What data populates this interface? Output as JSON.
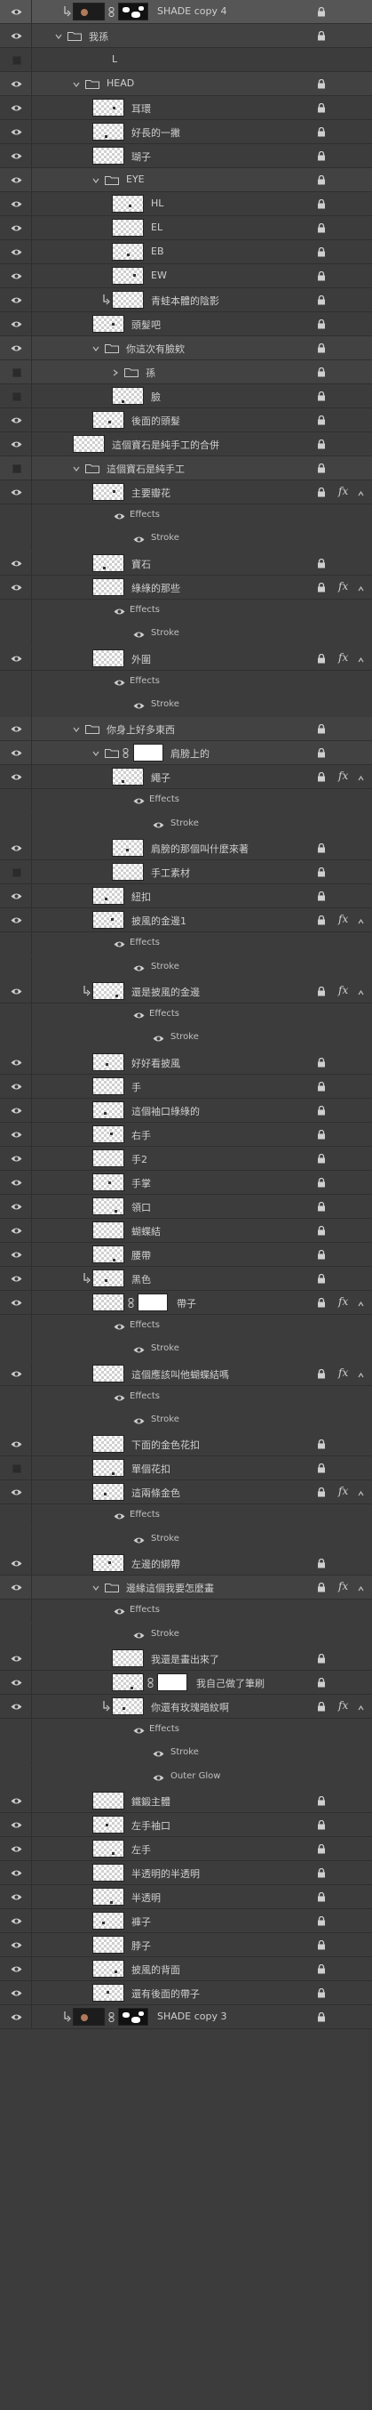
{
  "layers": [
    {
      "type": "layer",
      "label": "SHADE copy 4",
      "indent": 2,
      "vis": "on",
      "clip": true,
      "thumb": "dark",
      "mask": "black",
      "lock": true,
      "selected": true
    },
    {
      "type": "group",
      "label": "我孫",
      "indent": 1,
      "vis": "on",
      "open": true,
      "lock": true
    },
    {
      "type": "layer",
      "label": "L",
      "indent": 2,
      "vis": "off",
      "thumb": "none"
    },
    {
      "type": "group",
      "label": "HEAD",
      "indent": 2,
      "vis": "on",
      "open": true,
      "lock": true
    },
    {
      "type": "layer",
      "label": "耳環",
      "indent": 3,
      "vis": "on",
      "thumb": "check",
      "lock": true
    },
    {
      "type": "layer",
      "label": "好長的一撇",
      "indent": 3,
      "vis": "on",
      "thumb": "check",
      "lock": true
    },
    {
      "type": "layer",
      "label": "瑚子",
      "indent": 3,
      "vis": "on",
      "thumb": "check",
      "lock": true
    },
    {
      "type": "group",
      "label": "EYE",
      "indent": 3,
      "vis": "on",
      "open": true,
      "lock": true
    },
    {
      "type": "layer",
      "label": "HL",
      "indent": 4,
      "vis": "on",
      "thumb": "check",
      "lock": true
    },
    {
      "type": "layer",
      "label": "EL",
      "indent": 4,
      "vis": "on",
      "thumb": "check",
      "lock": true
    },
    {
      "type": "layer",
      "label": "EB",
      "indent": 4,
      "vis": "on",
      "thumb": "check",
      "lock": true
    },
    {
      "type": "layer",
      "label": "EW",
      "indent": 4,
      "vis": "on",
      "thumb": "check",
      "lock": true
    },
    {
      "type": "layer",
      "label": "青蛙本體的陰影",
      "indent": 4,
      "vis": "on",
      "clip": true,
      "thumb": "check",
      "lock": true
    },
    {
      "type": "layer",
      "label": "頭髮吧",
      "indent": 3,
      "vis": "on",
      "thumb": "check",
      "lock": true
    },
    {
      "type": "group",
      "label": "你這次有臉欸",
      "indent": 3,
      "vis": "on",
      "open": true,
      "lock": true
    },
    {
      "type": "group",
      "label": "孫",
      "indent": 4,
      "vis": "off",
      "open": false,
      "lock": true
    },
    {
      "type": "layer",
      "label": "臉",
      "indent": 4,
      "vis": "off",
      "thumb": "check",
      "lock": true
    },
    {
      "type": "layer",
      "label": "後面的頭髮",
      "indent": 3,
      "vis": "on",
      "thumb": "check",
      "lock": true
    },
    {
      "type": "layer",
      "label": "這個寶石是純手工的合併",
      "indent": 2,
      "vis": "on",
      "thumb": "check",
      "lock": true
    },
    {
      "type": "group",
      "label": "這個寶石是純手工",
      "indent": 2,
      "vis": "off",
      "open": true,
      "lock": true
    },
    {
      "type": "layer",
      "label": "主要瓣花",
      "indent": 3,
      "vis": "on",
      "thumb": "check",
      "lock": true,
      "fx": true
    },
    {
      "type": "effects",
      "label": "Effects",
      "indent": 3
    },
    {
      "type": "effect",
      "label": "Stroke",
      "indent": 3
    },
    {
      "type": "layer",
      "label": "寶石",
      "indent": 3,
      "vis": "on",
      "thumb": "check",
      "lock": true
    },
    {
      "type": "layer",
      "label": "綠綠的那些",
      "indent": 3,
      "vis": "on",
      "thumb": "check",
      "lock": true,
      "fx": true
    },
    {
      "type": "effects",
      "label": "Effects",
      "indent": 3
    },
    {
      "type": "effect",
      "label": "Stroke",
      "indent": 3
    },
    {
      "type": "layer",
      "label": "外圍",
      "indent": 3,
      "vis": "on",
      "thumb": "check",
      "lock": true,
      "fx": true
    },
    {
      "type": "effects",
      "label": "Effects",
      "indent": 3
    },
    {
      "type": "effect",
      "label": "Stroke",
      "indent": 3
    },
    {
      "type": "group",
      "label": "你身上好多東西",
      "indent": 2,
      "vis": "on",
      "open": true,
      "lock": true
    },
    {
      "type": "group",
      "label": "肩膀上的",
      "indent": 3,
      "vis": "on",
      "open": true,
      "lock": true,
      "mask": "white"
    },
    {
      "type": "layer",
      "label": "繩子",
      "indent": 4,
      "vis": "on",
      "thumb": "check",
      "lock": true,
      "fx": true
    },
    {
      "type": "effects",
      "label": "Effects",
      "indent": 4
    },
    {
      "type": "effect",
      "label": "Stroke",
      "indent": 4
    },
    {
      "type": "layer",
      "label": "肩膀的那個叫什麼來著",
      "indent": 4,
      "vis": "on",
      "thumb": "check",
      "lock": true
    },
    {
      "type": "layer",
      "label": "手工素材",
      "indent": 4,
      "vis": "off",
      "thumb": "check",
      "lock": true
    },
    {
      "type": "layer",
      "label": "紐扣",
      "indent": 3,
      "vis": "on",
      "thumb": "check",
      "lock": true
    },
    {
      "type": "layer",
      "label": "披風的金邊1",
      "indent": 3,
      "vis": "on",
      "thumb": "check",
      "lock": true,
      "fx": true
    },
    {
      "type": "effects",
      "label": "Effects",
      "indent": 3
    },
    {
      "type": "effect",
      "label": "Stroke",
      "indent": 3
    },
    {
      "type": "layer",
      "label": "還是披風的金邊",
      "indent": 3,
      "vis": "on",
      "clip": true,
      "thumb": "check",
      "lock": true,
      "fx": true
    },
    {
      "type": "effects",
      "label": "Effects",
      "indent": 4
    },
    {
      "type": "effect",
      "label": "Stroke",
      "indent": 4
    },
    {
      "type": "layer",
      "label": "好好看披風",
      "indent": 3,
      "vis": "on",
      "thumb": "check",
      "lock": true
    },
    {
      "type": "layer",
      "label": "手",
      "indent": 3,
      "vis": "on",
      "thumb": "check",
      "lock": true
    },
    {
      "type": "layer",
      "label": "這個袖口綠綠的",
      "indent": 3,
      "vis": "on",
      "thumb": "check",
      "lock": true
    },
    {
      "type": "layer",
      "label": "右手",
      "indent": 3,
      "vis": "on",
      "thumb": "check",
      "lock": true
    },
    {
      "type": "layer",
      "label": "手2",
      "indent": 3,
      "vis": "on",
      "thumb": "check",
      "lock": true
    },
    {
      "type": "layer",
      "label": "手掌",
      "indent": 3,
      "vis": "on",
      "thumb": "check",
      "lock": true
    },
    {
      "type": "layer",
      "label": "領口",
      "indent": 3,
      "vis": "on",
      "thumb": "check",
      "lock": true
    },
    {
      "type": "layer",
      "label": "蝴蝶結",
      "indent": 3,
      "vis": "on",
      "thumb": "check",
      "lock": true
    },
    {
      "type": "layer",
      "label": "腰帶",
      "indent": 3,
      "vis": "on",
      "thumb": "check",
      "lock": true
    },
    {
      "type": "layer",
      "label": "黑色",
      "indent": 3,
      "vis": "on",
      "clip": true,
      "thumb": "check",
      "lock": true
    },
    {
      "type": "layer",
      "label": "帶子",
      "indent": 3,
      "vis": "on",
      "thumb": "check",
      "lock": true,
      "fx": true,
      "mask": "white"
    },
    {
      "type": "effects",
      "label": "Effects",
      "indent": 3
    },
    {
      "type": "effect",
      "label": "Stroke",
      "indent": 3
    },
    {
      "type": "layer",
      "label": "這個應該叫他蝴蝶結嗎",
      "indent": 3,
      "vis": "on",
      "thumb": "check",
      "lock": true,
      "fx": true
    },
    {
      "type": "effects",
      "label": "Effects",
      "indent": 3
    },
    {
      "type": "effect",
      "label": "Stroke",
      "indent": 3
    },
    {
      "type": "layer",
      "label": "下面的金色花扣",
      "indent": 3,
      "vis": "on",
      "thumb": "check",
      "lock": true
    },
    {
      "type": "layer",
      "label": "單個花扣",
      "indent": 3,
      "vis": "off",
      "thumb": "check",
      "lock": true
    },
    {
      "type": "layer",
      "label": "這兩條金色",
      "indent": 3,
      "vis": "on",
      "thumb": "check",
      "lock": true,
      "fx": true
    },
    {
      "type": "effects",
      "label": "Effects",
      "indent": 3
    },
    {
      "type": "effect",
      "label": "Stroke",
      "indent": 3
    },
    {
      "type": "layer",
      "label": "左邊的綁帶",
      "indent": 3,
      "vis": "on",
      "thumb": "check",
      "lock": true
    },
    {
      "type": "group",
      "label": "邊緣這個我要怎麼畫",
      "indent": 3,
      "vis": "on",
      "open": true,
      "lock": true,
      "fx": true
    },
    {
      "type": "effects",
      "label": "Effects",
      "indent": 3
    },
    {
      "type": "effect",
      "label": "Stroke",
      "indent": 3
    },
    {
      "type": "layer",
      "label": "我還是畫出來了",
      "indent": 4,
      "vis": "on",
      "thumb": "check",
      "lock": true
    },
    {
      "type": "layer",
      "label": "我自己做了筆刷",
      "indent": 4,
      "vis": "on",
      "thumb": "check",
      "lock": true,
      "mask": "white",
      "chainOnly": true
    },
    {
      "type": "layer",
      "label": "你還有玫瑰暗紋啊",
      "indent": 4,
      "vis": "on",
      "clip": true,
      "thumb": "check",
      "lock": true,
      "fx": true
    },
    {
      "type": "effects",
      "label": "Effects",
      "indent": 4
    },
    {
      "type": "effect",
      "label": "Stroke",
      "indent": 4
    },
    {
      "type": "effect",
      "label": "Outer Glow",
      "indent": 4
    },
    {
      "type": "layer",
      "label": "鐵鍛主體",
      "indent": 3,
      "vis": "on",
      "thumb": "check",
      "lock": true
    },
    {
      "type": "layer",
      "label": "左手袖口",
      "indent": 3,
      "vis": "on",
      "thumb": "check",
      "lock": true
    },
    {
      "type": "layer",
      "label": "左手",
      "indent": 3,
      "vis": "on",
      "thumb": "check",
      "lock": true
    },
    {
      "type": "layer",
      "label": "半透明的半透明",
      "indent": 3,
      "vis": "on",
      "thumb": "check",
      "lock": true
    },
    {
      "type": "layer",
      "label": "半透明",
      "indent": 3,
      "vis": "on",
      "thumb": "check",
      "lock": true
    },
    {
      "type": "layer",
      "label": "褲子",
      "indent": 3,
      "vis": "on",
      "thumb": "check",
      "lock": true
    },
    {
      "type": "layer",
      "label": "脖子",
      "indent": 3,
      "vis": "on",
      "thumb": "check",
      "lock": true
    },
    {
      "type": "layer",
      "label": "披風的背面",
      "indent": 3,
      "vis": "on",
      "thumb": "check",
      "lock": true
    },
    {
      "type": "layer",
      "label": "還有後面的帶子",
      "indent": 3,
      "vis": "on",
      "thumb": "check",
      "lock": true
    },
    {
      "type": "layer",
      "label": "SHADE copy 3",
      "indent": 2,
      "vis": "on",
      "clip": true,
      "thumb": "dark",
      "mask": "black",
      "lock": true
    }
  ]
}
